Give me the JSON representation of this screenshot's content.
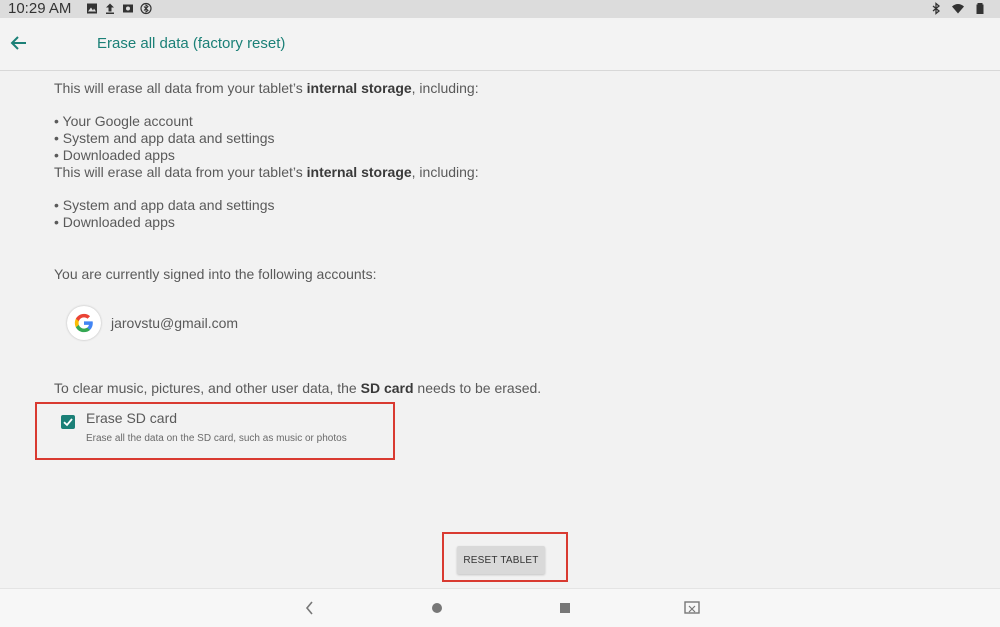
{
  "status_bar": {
    "time": "10:29 AM",
    "left_icons": [
      "image-icon",
      "upload-icon",
      "photo-icon",
      "bluetooth-circle-icon"
    ],
    "right_icons": [
      "bluetooth-icon",
      "wifi-icon",
      "battery-icon"
    ]
  },
  "app_bar": {
    "title": "Erase all data (factory reset)",
    "back_icon": "arrow-left-icon",
    "accent_color": "#1b8077"
  },
  "content": {
    "intro_1_prefix": "This will erase all data from your tablet’s ",
    "intro_1_bold": "internal storage",
    "intro_1_suffix": ", including:",
    "list_1": [
      "• Your Google account",
      "• System and app data and settings",
      "• Downloaded apps"
    ],
    "intro_2_prefix": "This will erase all data from your tablet’s ",
    "intro_2_bold": "internal storage",
    "intro_2_suffix": ", including:",
    "list_2": [
      "• System and app data and settings",
      "• Downloaded apps"
    ],
    "accounts_text": "You are currently signed into the following accounts:",
    "account_email": "jarovstu@gmail.com",
    "sd_note_prefix": "To clear music, pictures, and other user data, the ",
    "sd_note_bold": "SD card",
    "sd_note_suffix": " needs to be erased.",
    "erase_sd_title": "Erase SD card",
    "erase_sd_subtitle": "Erase all the data on the SD card, such as music or photos",
    "erase_sd_checked": true,
    "reset_button": "RESET TABLET"
  },
  "nav_bar": {
    "icons": [
      "back-triangle-icon",
      "home-circle-icon",
      "recents-square-icon",
      "screenshot-icon"
    ]
  },
  "highlight_color": "#d93a31"
}
